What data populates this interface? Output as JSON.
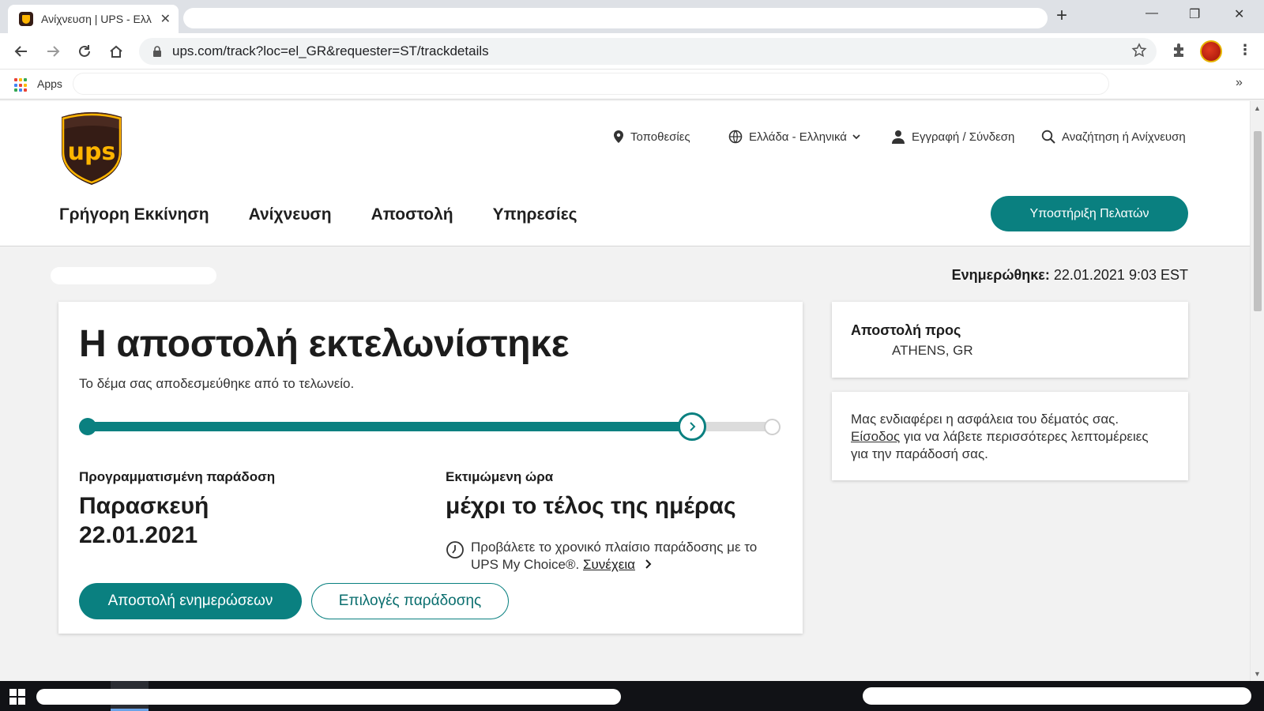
{
  "browser": {
    "tab_title": "Ανίχνευση | UPS - Ελλάδα",
    "tab_close": "✕",
    "new_tab": "+",
    "url": "ups.com/track?loc=el_GR&requester=ST/trackdetails",
    "bookmarks_apps": "Apps",
    "more": "»"
  },
  "header": {
    "utility": {
      "locations": "Τοποθεσίες",
      "language": "Ελλάδα - Ελληνικά",
      "login": "Εγγραφή / Σύνδεση",
      "search": "Αναζήτηση ή Ανίχνευση"
    },
    "nav": [
      "Γρήγορη Εκκίνηση",
      "Ανίχνευση",
      "Αποστολή",
      "Υπηρεσίες"
    ],
    "support_button": "Υποστήριξη Πελατών"
  },
  "tracking": {
    "updated_label": "Ενημερώθηκε:",
    "updated_value": "22.01.2021 9:03 EST",
    "status_title": "Η αποστολή εκτελωνίστηκε",
    "status_sub": "Το δέμα σας αποδεσμεύθηκε από το τελωνείο.",
    "progress_fraction": 0.88,
    "scheduled_label": "Προγραμματισμένη παράδοση",
    "scheduled_day": "Παρασκευή",
    "scheduled_date": "22.01.2021",
    "time_label": "Εκτιμώμενη ώρα",
    "time_value": "μέχρι το τέλος της ημέρας",
    "mychoice_text": "Προβάλετε το χρονικό πλαίσιο παράδοσης με το UPS My Choice®.",
    "mychoice_link": "Συνέχεια",
    "btn_updates": "Αποστολή ενημερώσεων",
    "btn_options": "Επιλογές παράδοσης"
  },
  "ship_to": {
    "label": "Αποστολή προς",
    "value": "ATHENS, GR"
  },
  "security": {
    "line1": "Μας ενδιαφέρει η ασφάλεια του δέματός σας.",
    "link": "Είσοδος",
    "line2": " για να λάβετε περισσότερες λεπτομέρειες για την παράδοσή σας."
  },
  "colors": {
    "accent": "#0a8080",
    "ups_brown": "#351c15",
    "ups_gold": "#ffb500"
  }
}
